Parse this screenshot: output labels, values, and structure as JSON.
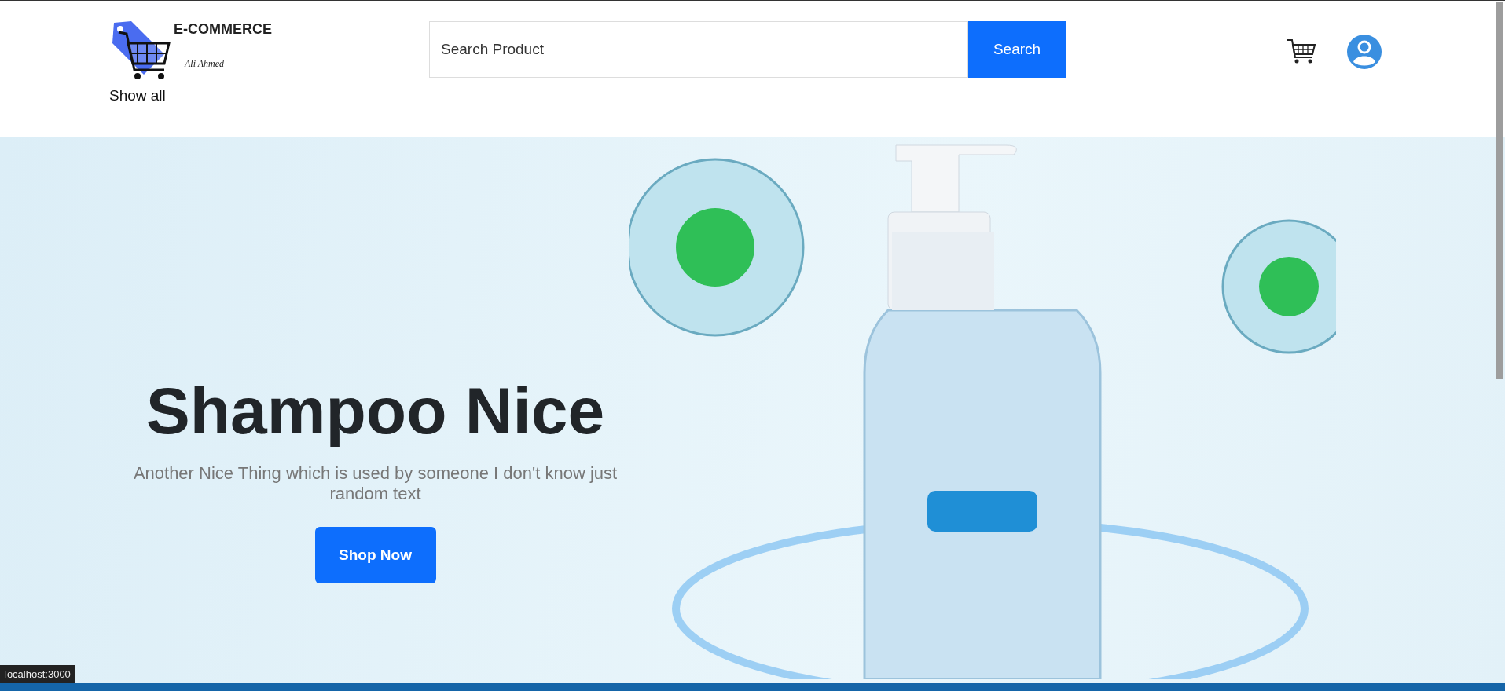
{
  "header": {
    "logo": {
      "title": "E-COMMERCE",
      "subtitle": "Ali Ahmed"
    },
    "search": {
      "placeholder": "Search Product",
      "button": "Search"
    },
    "nav_link": "Show all"
  },
  "hero": {
    "title": "Shampoo Nice",
    "text": "Another Nice Thing which is used by someone I don't know just random text",
    "button": "Shop Now"
  },
  "status_bar": {
    "url": "localhost:3000"
  }
}
